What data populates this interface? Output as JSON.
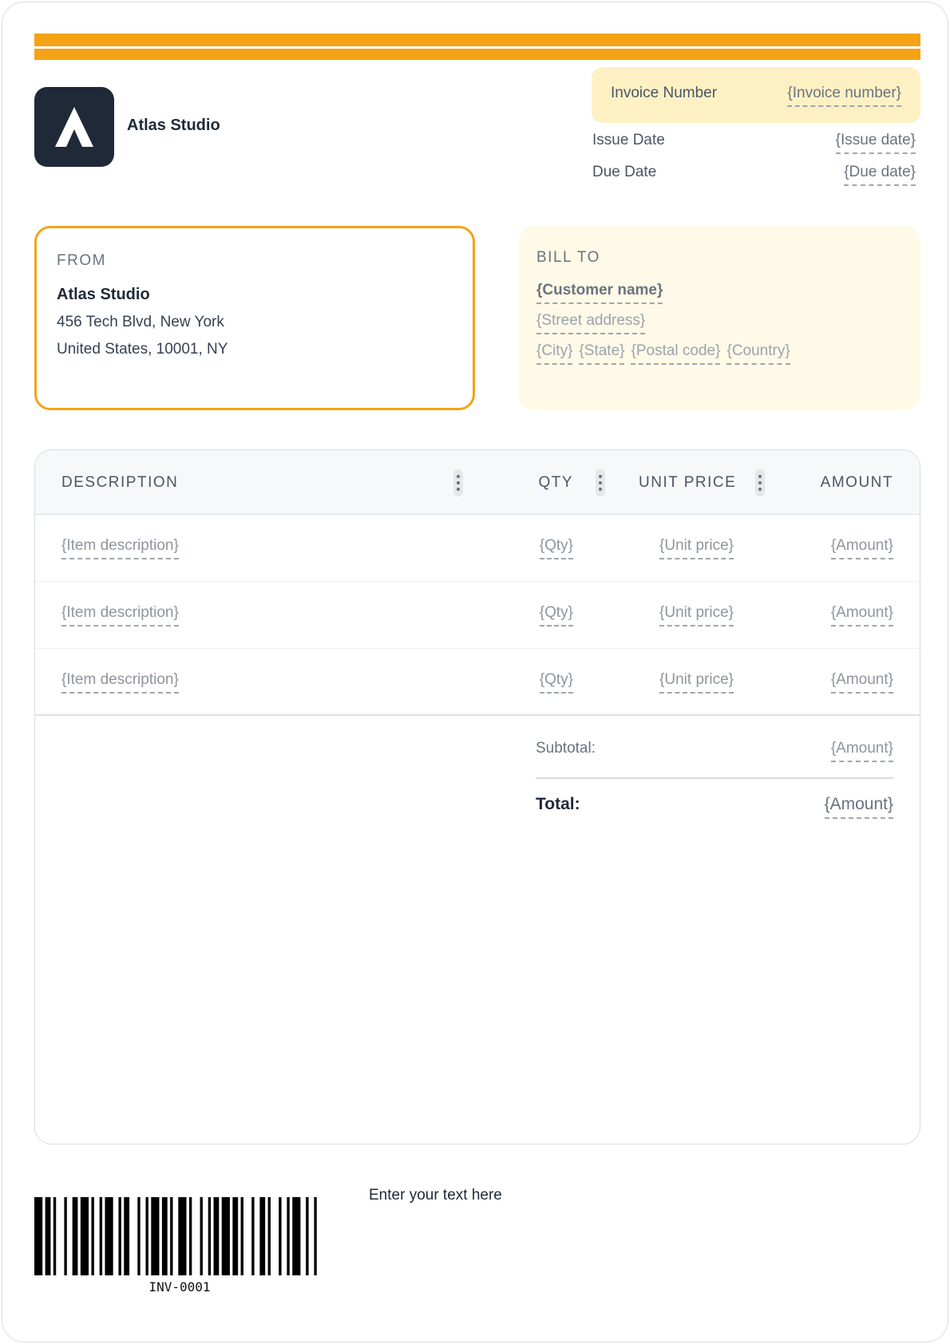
{
  "stripes": {
    "color": "#f5a316"
  },
  "brand": {
    "name": "Atlas Studio",
    "logo_icon": "atlas-a-logo-icon"
  },
  "invoice_meta": {
    "invoice_number_label": "Invoice Number",
    "invoice_number_value": "{Invoice number}",
    "issue_date_label": "Issue Date",
    "issue_date_value": "{Issue date}",
    "due_date_label": "Due Date",
    "due_date_value": "{Due date}"
  },
  "from": {
    "title": "FROM",
    "name": "Atlas Studio",
    "address_line1": "456 Tech Blvd, New York",
    "address_line2": "United States, 10001, NY"
  },
  "bill_to": {
    "title": "BILL TO",
    "customer_name": "{Customer name}",
    "street_address": "{Street address}",
    "city": "{City}",
    "state": "{State}",
    "postal_code": "{Postal code}",
    "country": "{Country}"
  },
  "table": {
    "headers": {
      "description": "DESCRIPTION",
      "qty": "QTY",
      "unit_price": "UNIT PRICE",
      "amount": "AMOUNT"
    },
    "rows": [
      {
        "description": "{Item description}",
        "qty": "{Qty}",
        "unit_price": "{Unit price}",
        "amount": "{Amount}"
      },
      {
        "description": "{Item description}",
        "qty": "{Qty}",
        "unit_price": "{Unit price}",
        "amount": "{Amount}"
      },
      {
        "description": "{Item description}",
        "qty": "{Qty}",
        "unit_price": "{Unit price}",
        "amount": "{Amount}"
      }
    ]
  },
  "totals": {
    "subtotal_label": "Subtotal:",
    "subtotal_value": "{Amount}",
    "total_label": "Total:",
    "total_value": "{Amount}"
  },
  "footer": {
    "barcode_text": "INV-0001",
    "note": "Enter your text here"
  }
}
